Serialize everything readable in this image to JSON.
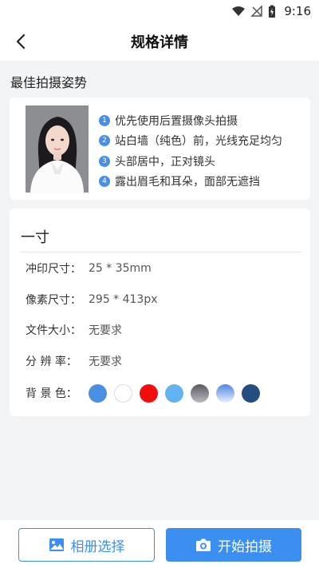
{
  "status_bar": {
    "time": "9:16"
  },
  "app_bar": {
    "title": "规格详情"
  },
  "best_pose": {
    "heading": "最佳拍摄姿势",
    "tips": [
      {
        "num": "1",
        "text": "优先使用后置摄像头拍摄"
      },
      {
        "num": "2",
        "text": "站白墙（纯色）前，光线充足均匀"
      },
      {
        "num": "3",
        "text": "头部居中，正对镜头"
      },
      {
        "num": "4",
        "text": "露出眉毛和耳朵，面部无遮挡"
      }
    ]
  },
  "spec": {
    "name": "一寸",
    "rows": [
      {
        "label": "冲印尺寸：",
        "value": "25 * 35mm"
      },
      {
        "label": "像素尺寸：",
        "value": "295 * 413px"
      },
      {
        "label": "文件大小：",
        "value": "无要求"
      },
      {
        "label": "分 辨 率：",
        "value": "无要求"
      }
    ],
    "background_label": "背 景 色：",
    "background_colors": [
      "#4a8fe0",
      "#ffffff",
      "#f20c0c",
      "#62b3ef",
      "linear-gradient(#5a5a60,#b8b8c0)",
      "linear-gradient(#4f86e6,#e8f0fb)",
      "#244e7f"
    ]
  },
  "bottom": {
    "album_label": "相册选择",
    "start_label": "开始拍摄"
  },
  "colors": {
    "accent": "#3b8ff0",
    "tip_badge": "#4a90e2"
  }
}
